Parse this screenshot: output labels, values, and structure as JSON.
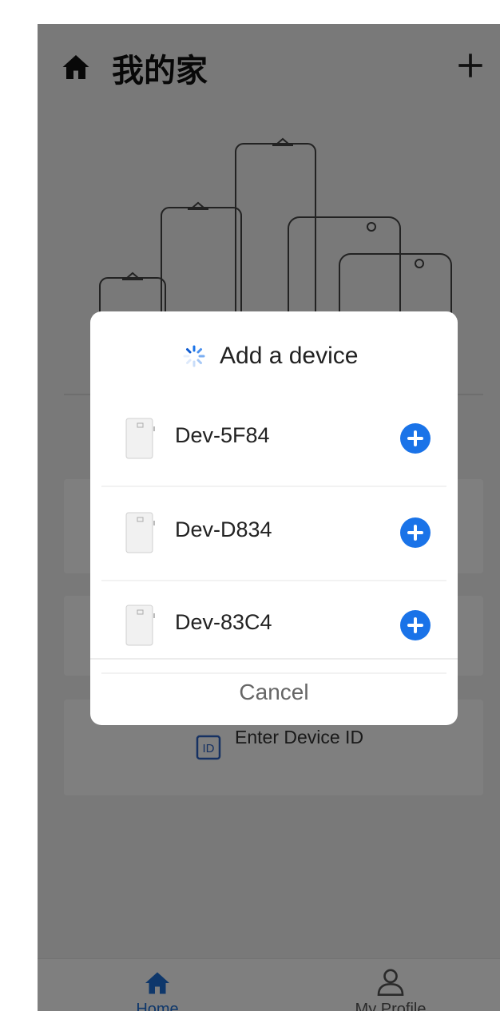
{
  "header": {
    "title": "我的家",
    "home_icon": "home-icon",
    "add_icon": "plus-icon"
  },
  "background_actions": {
    "enter_id_label": "Enter Device ID",
    "id_icon": "id-card-icon"
  },
  "tabbar": {
    "home_label": "Home",
    "profile_label": "My Profile",
    "active_color": "#1d6fd6"
  },
  "dialog": {
    "title": "Add a device",
    "cancel_label": "Cancel",
    "add_button_color": "#1a73e8",
    "devices": [
      {
        "name": "Dev-5F84"
      },
      {
        "name": "Dev-D834"
      },
      {
        "name": "Dev-83C4"
      }
    ]
  }
}
